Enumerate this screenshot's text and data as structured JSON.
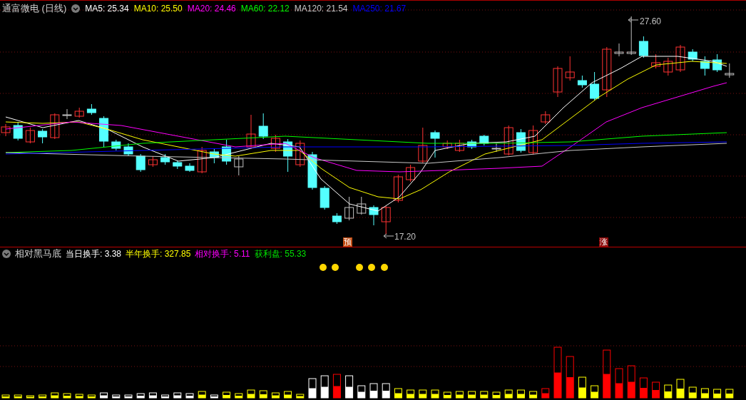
{
  "main_chart": {
    "title": "通富微电 (日线)",
    "legend": [
      {
        "label": "MA5: 25.34",
        "color": "#ffffff"
      },
      {
        "label": "MA10: 25.50",
        "color": "#ffff00"
      },
      {
        "label": "MA20: 24.46",
        "color": "#ff00ff"
      },
      {
        "label": "MA60: 22.12",
        "color": "#00ff00"
      },
      {
        "label": "MA120: 21.54",
        "color": "#c8c8c8"
      },
      {
        "label": "MA250: 21.67",
        "color": "#0000ff"
      }
    ],
    "high_label": "27.60",
    "low_label": "17.20",
    "markers": [
      {
        "text": "预",
        "color": "#c04a10"
      },
      {
        "text": "涨",
        "color": "#8b0a0a"
      }
    ]
  },
  "indicator": {
    "title": "相对黑马底",
    "legend": [
      {
        "label": "当日换手: 3.38",
        "color": "#ffffff"
      },
      {
        "label": "半年换手: 327.85",
        "color": "#ffff00"
      },
      {
        "label": "相对换手: 5.11",
        "color": "#ff00ff"
      },
      {
        "label": "获利盘: 55.33",
        "color": "#00e000"
      }
    ]
  }
}
